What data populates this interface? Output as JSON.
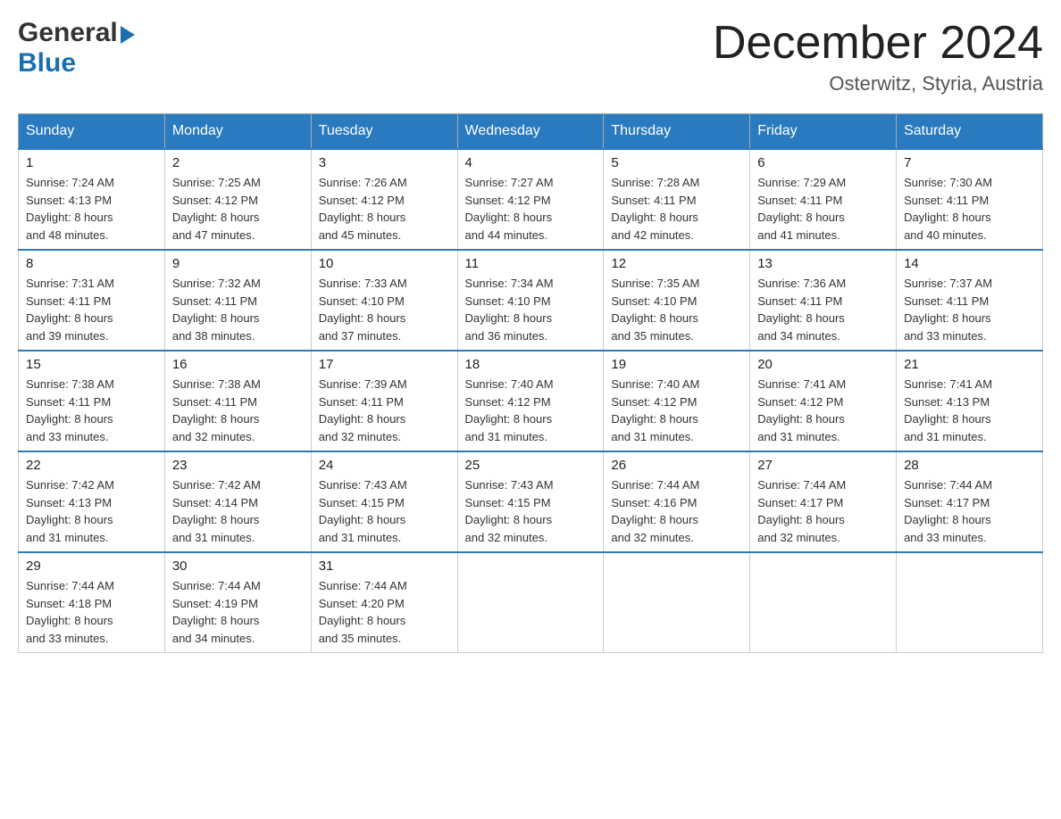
{
  "header": {
    "logo_general": "General",
    "logo_blue": "Blue",
    "month_title": "December 2024",
    "location": "Osterwitz, Styria, Austria"
  },
  "days_of_week": [
    "Sunday",
    "Monday",
    "Tuesday",
    "Wednesday",
    "Thursday",
    "Friday",
    "Saturday"
  ],
  "weeks": [
    [
      {
        "day": "1",
        "sunrise": "7:24 AM",
        "sunset": "4:13 PM",
        "daylight": "8 hours and 48 minutes."
      },
      {
        "day": "2",
        "sunrise": "7:25 AM",
        "sunset": "4:12 PM",
        "daylight": "8 hours and 47 minutes."
      },
      {
        "day": "3",
        "sunrise": "7:26 AM",
        "sunset": "4:12 PM",
        "daylight": "8 hours and 45 minutes."
      },
      {
        "day": "4",
        "sunrise": "7:27 AM",
        "sunset": "4:12 PM",
        "daylight": "8 hours and 44 minutes."
      },
      {
        "day": "5",
        "sunrise": "7:28 AM",
        "sunset": "4:11 PM",
        "daylight": "8 hours and 42 minutes."
      },
      {
        "day": "6",
        "sunrise": "7:29 AM",
        "sunset": "4:11 PM",
        "daylight": "8 hours and 41 minutes."
      },
      {
        "day": "7",
        "sunrise": "7:30 AM",
        "sunset": "4:11 PM",
        "daylight": "8 hours and 40 minutes."
      }
    ],
    [
      {
        "day": "8",
        "sunrise": "7:31 AM",
        "sunset": "4:11 PM",
        "daylight": "8 hours and 39 minutes."
      },
      {
        "day": "9",
        "sunrise": "7:32 AM",
        "sunset": "4:11 PM",
        "daylight": "8 hours and 38 minutes."
      },
      {
        "day": "10",
        "sunrise": "7:33 AM",
        "sunset": "4:10 PM",
        "daylight": "8 hours and 37 minutes."
      },
      {
        "day": "11",
        "sunrise": "7:34 AM",
        "sunset": "4:10 PM",
        "daylight": "8 hours and 36 minutes."
      },
      {
        "day": "12",
        "sunrise": "7:35 AM",
        "sunset": "4:10 PM",
        "daylight": "8 hours and 35 minutes."
      },
      {
        "day": "13",
        "sunrise": "7:36 AM",
        "sunset": "4:11 PM",
        "daylight": "8 hours and 34 minutes."
      },
      {
        "day": "14",
        "sunrise": "7:37 AM",
        "sunset": "4:11 PM",
        "daylight": "8 hours and 33 minutes."
      }
    ],
    [
      {
        "day": "15",
        "sunrise": "7:38 AM",
        "sunset": "4:11 PM",
        "daylight": "8 hours and 33 minutes."
      },
      {
        "day": "16",
        "sunrise": "7:38 AM",
        "sunset": "4:11 PM",
        "daylight": "8 hours and 32 minutes."
      },
      {
        "day": "17",
        "sunrise": "7:39 AM",
        "sunset": "4:11 PM",
        "daylight": "8 hours and 32 minutes."
      },
      {
        "day": "18",
        "sunrise": "7:40 AM",
        "sunset": "4:12 PM",
        "daylight": "8 hours and 31 minutes."
      },
      {
        "day": "19",
        "sunrise": "7:40 AM",
        "sunset": "4:12 PM",
        "daylight": "8 hours and 31 minutes."
      },
      {
        "day": "20",
        "sunrise": "7:41 AM",
        "sunset": "4:12 PM",
        "daylight": "8 hours and 31 minutes."
      },
      {
        "day": "21",
        "sunrise": "7:41 AM",
        "sunset": "4:13 PM",
        "daylight": "8 hours and 31 minutes."
      }
    ],
    [
      {
        "day": "22",
        "sunrise": "7:42 AM",
        "sunset": "4:13 PM",
        "daylight": "8 hours and 31 minutes."
      },
      {
        "day": "23",
        "sunrise": "7:42 AM",
        "sunset": "4:14 PM",
        "daylight": "8 hours and 31 minutes."
      },
      {
        "day": "24",
        "sunrise": "7:43 AM",
        "sunset": "4:15 PM",
        "daylight": "8 hours and 31 minutes."
      },
      {
        "day": "25",
        "sunrise": "7:43 AM",
        "sunset": "4:15 PM",
        "daylight": "8 hours and 32 minutes."
      },
      {
        "day": "26",
        "sunrise": "7:44 AM",
        "sunset": "4:16 PM",
        "daylight": "8 hours and 32 minutes."
      },
      {
        "day": "27",
        "sunrise": "7:44 AM",
        "sunset": "4:17 PM",
        "daylight": "8 hours and 32 minutes."
      },
      {
        "day": "28",
        "sunrise": "7:44 AM",
        "sunset": "4:17 PM",
        "daylight": "8 hours and 33 minutes."
      }
    ],
    [
      {
        "day": "29",
        "sunrise": "7:44 AM",
        "sunset": "4:18 PM",
        "daylight": "8 hours and 33 minutes."
      },
      {
        "day": "30",
        "sunrise": "7:44 AM",
        "sunset": "4:19 PM",
        "daylight": "8 hours and 34 minutes."
      },
      {
        "day": "31",
        "sunrise": "7:44 AM",
        "sunset": "4:20 PM",
        "daylight": "8 hours and 35 minutes."
      },
      null,
      null,
      null,
      null
    ]
  ],
  "labels": {
    "sunrise": "Sunrise: ",
    "sunset": "Sunset: ",
    "daylight": "Daylight: "
  }
}
